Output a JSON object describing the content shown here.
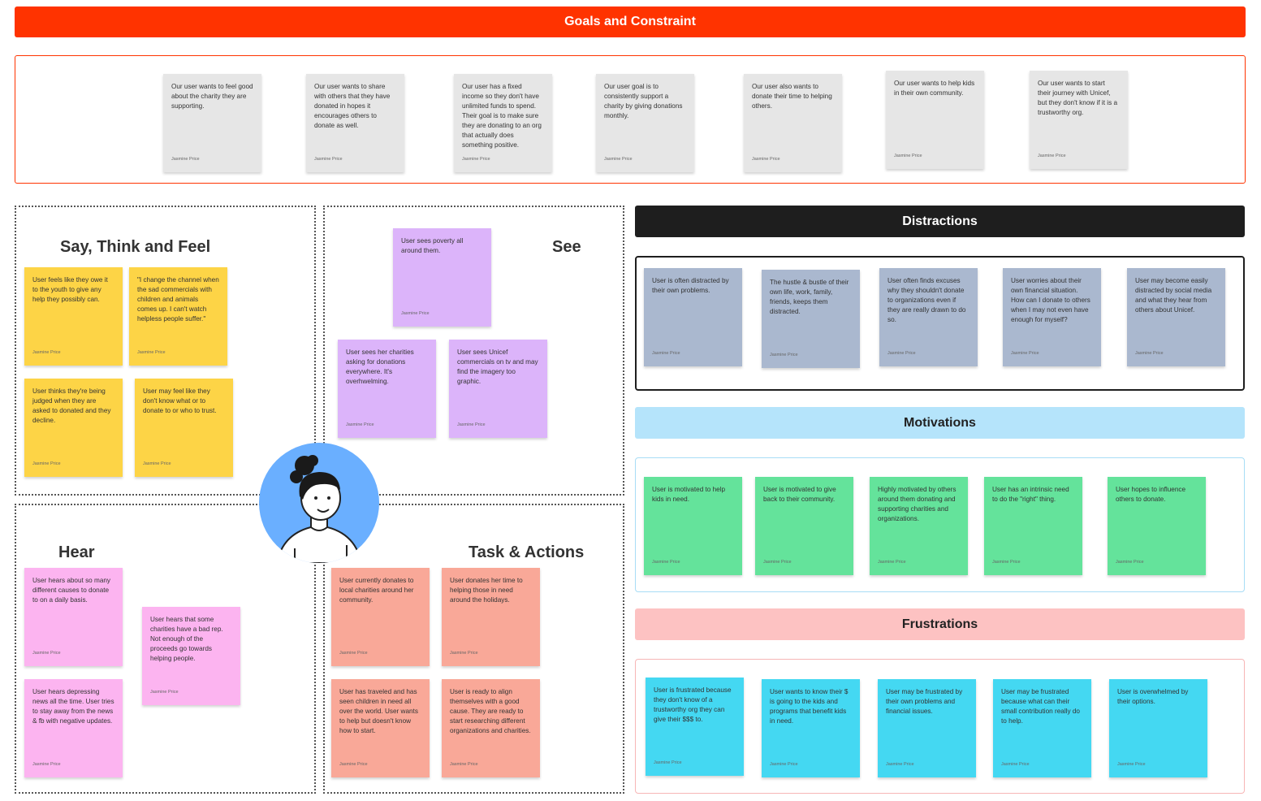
{
  "goals": {
    "title": "Goals and Constraint",
    "notes": [
      {
        "text": "Our user wants to feel good about the charity they are supporting.",
        "author": "Jasmine Price"
      },
      {
        "text": "Our user wants to share with others that they have donated in hopes it encourages others to donate as well.",
        "author": "Jasmine Price"
      },
      {
        "text": "Our user has a fixed income so they don't have unlimited funds to spend. Their goal is to make sure they are donating to an org that actually does something positive.",
        "author": "Jasmine Price"
      },
      {
        "text": "Our user goal is to consistently support a charity by giving donations monthly.",
        "author": "Jasmine Price"
      },
      {
        "text": "Our user also wants to donate their time to helping others.",
        "author": "Jasmine Price"
      },
      {
        "text": "Our user wants to help kids in their own community.",
        "author": "Jasmine Price"
      },
      {
        "text": "Our user wants to start their journey with Unicef, but they don't know if it is a trustworthy org.",
        "author": "Jasmine Price"
      }
    ]
  },
  "say_think_feel": {
    "title": "Say, Think and Feel",
    "notes": [
      {
        "text": "User feels like they owe it to the youth to give any help they possibly can.",
        "author": "Jasmine Price"
      },
      {
        "text": "\"I change the channel when the sad commercials with children and animals comes up. I can't watch helpless people suffer.\"",
        "author": "Jasmine Price"
      },
      {
        "text": "User thinks they're being judged when they are asked to donated and they decline.",
        "author": "Jasmine Price"
      },
      {
        "text": "User may feel like they don't know what or to donate to or who to trust.",
        "author": "Jasmine Price"
      }
    ]
  },
  "see": {
    "title": "See",
    "notes": [
      {
        "text": "User sees poverty all around them.",
        "author": "Jasmine Price"
      },
      {
        "text": "User sees her charities asking for donations everywhere. It's overhwelming.",
        "author": "Jasmine Price"
      },
      {
        "text": "User sees Unicef commercials on tv and may find the imagery too graphic.",
        "author": "Jasmine Price"
      }
    ]
  },
  "hear": {
    "title": "Hear",
    "notes": [
      {
        "text": "User hears about so many different causes to donate to on a daily basis.",
        "author": "Jasmine Price"
      },
      {
        "text": "User hears that some charities have a bad rep. Not enough of the proceeds go towards helping people.",
        "author": "Jasmine Price"
      },
      {
        "text": "User hears depressing news all the time. User tries to stay away from the news & fb with negative updates.",
        "author": "Jasmine Price"
      }
    ]
  },
  "tasks": {
    "title": "Task & Actions",
    "notes": [
      {
        "text": "User currently donates to local charities around her community.",
        "author": "Jasmine Price"
      },
      {
        "text": "User donates her time to helping those in need around the holidays.",
        "author": "Jasmine Price"
      },
      {
        "text": "User has traveled and has seen children in need all over the world. User wants to help but doesn't know how to start.",
        "author": "Jasmine Price"
      },
      {
        "text": "User is ready to align themselves with a good cause. They are ready to start researching different organizations and charities.",
        "author": "Jasmine Price"
      }
    ]
  },
  "distractions": {
    "title": "Distractions",
    "notes": [
      {
        "text": "User is often distracted by their own problems.",
        "author": "Jasmine Price"
      },
      {
        "text": "The hustle & bustle of their own life, work, family, friends, keeps them distracted.",
        "author": "Jasmine Price"
      },
      {
        "text": "User often finds excuses why they shouldn't donate to organizations even if they are really drawn to do so.",
        "author": "Jasmine Price"
      },
      {
        "text": "User worries about their own financial situation. How can I donate to others when I may not even have enough for myself?",
        "author": "Jasmine Price"
      },
      {
        "text": "User may become easily distracted by social media and what they hear from others about Unicef.",
        "author": "Jasmine Price"
      }
    ]
  },
  "motivations": {
    "title": "Motivations",
    "notes": [
      {
        "text": "User is motivated to help kids in need.",
        "author": "Jasmine Price"
      },
      {
        "text": "User is motivated to give back to their community.",
        "author": "Jasmine Price"
      },
      {
        "text": "Highly motivated by others around them donating and supporting charities and organizations.",
        "author": "Jasmine Price"
      },
      {
        "text": "User has an intrinsic need to do the \"right\" thing.",
        "author": "Jasmine Price"
      },
      {
        "text": "User hopes to influence others to donate.",
        "author": "Jasmine Price"
      }
    ]
  },
  "frustrations": {
    "title": "Frustrations",
    "notes": [
      {
        "text": "User is frustrated because they don't know of a trustworthy org they can give their $$$ to.",
        "author": "Jasmine Price"
      },
      {
        "text": "User wants to know their $ is going to the kids and programs that benefit kids in need.",
        "author": "Jasmine Price"
      },
      {
        "text": "User may be frustrated by their own problems and financial issues.",
        "author": "Jasmine Price"
      },
      {
        "text": "User may be frustrated because what can their small contribution really do to help.",
        "author": "Jasmine Price"
      },
      {
        "text": "User is overwhelmed by their options.",
        "author": "Jasmine Price"
      }
    ]
  },
  "colors": {
    "goals_banner": "#ff3300",
    "distractions_banner": "#1e1e1e",
    "motivations_banner": "#b5e4fb",
    "frustrations_banner": "#fdc2c2",
    "avatar_bg": "#6aafff"
  }
}
